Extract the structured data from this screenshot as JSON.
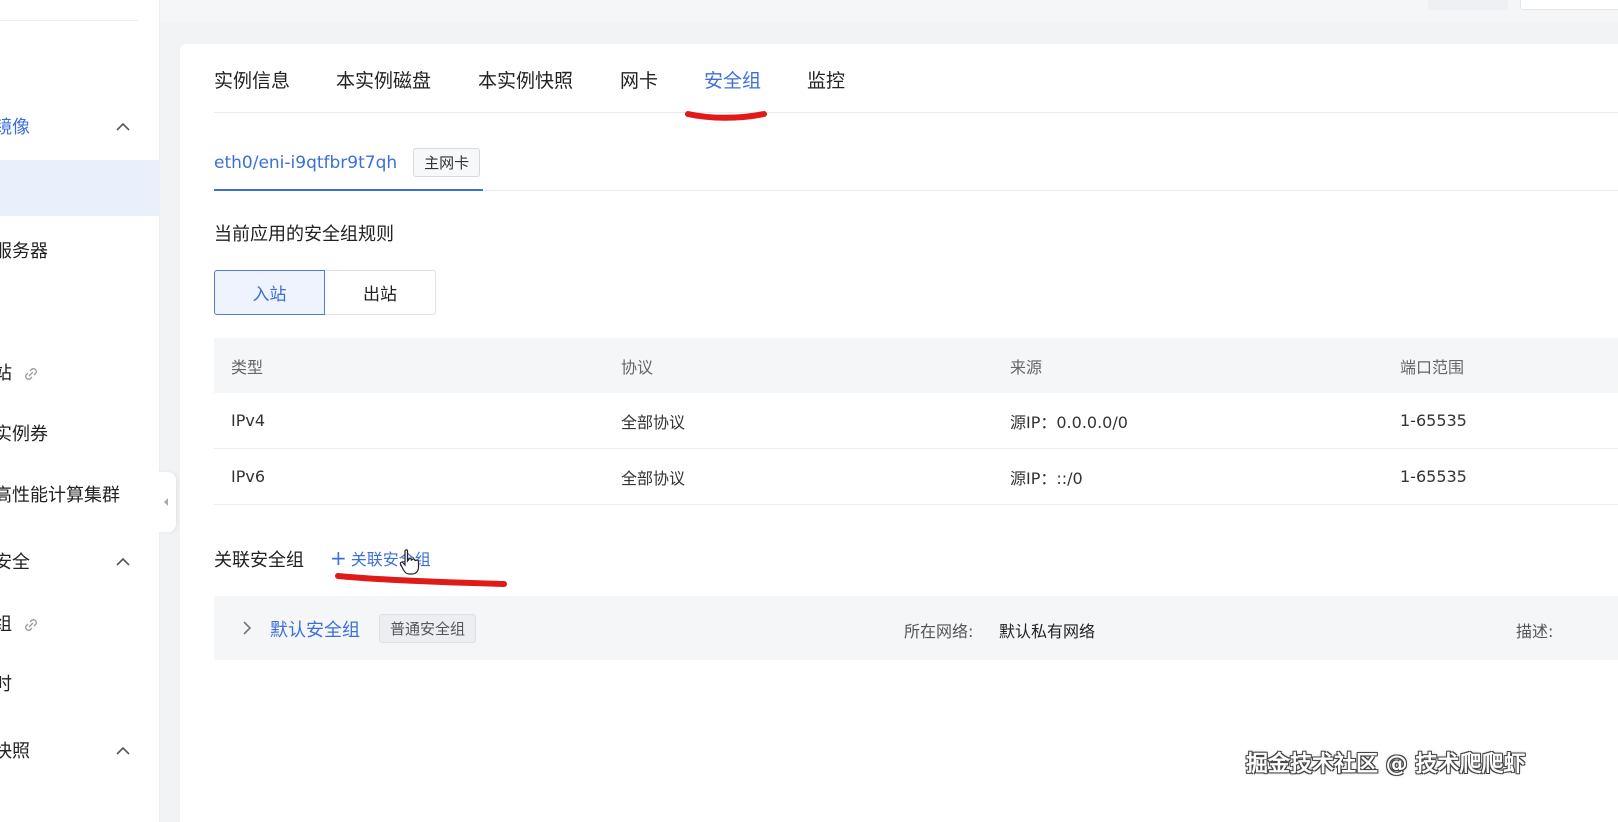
{
  "sidebar": {
    "items": [
      {
        "label": "镜像",
        "state": "group-expanded"
      },
      {
        "label": "",
        "state": "selected"
      },
      {
        "label": "服务器"
      },
      {
        "label": "站"
      },
      {
        "label": "实例券"
      },
      {
        "label": "高性能计算集群"
      },
      {
        "label": "安全",
        "state": "group-expanded"
      },
      {
        "label": "组"
      },
      {
        "label": "时"
      },
      {
        "label": "快照",
        "state": "group-expanded"
      }
    ]
  },
  "tabs": {
    "items": [
      "实例信息",
      "本实例磁盘",
      "本实例快照",
      "网卡",
      "安全组",
      "监控"
    ],
    "active": "安全组"
  },
  "nic": {
    "name": "eth0/eni-i9qtfbr9t7qh",
    "tag": "主网卡"
  },
  "rules_section": {
    "title": "当前应用的安全组规则",
    "directions": [
      "入站",
      "出站"
    ],
    "active_direction": "入站",
    "columns": [
      "类型",
      "协议",
      "来源",
      "端口范围"
    ],
    "rows": [
      [
        "IPv4",
        "全部协议",
        "源IP：0.0.0.0/0",
        "1-65535"
      ],
      [
        "IPv6",
        "全部协议",
        "源IP：::/0",
        "1-65535"
      ]
    ]
  },
  "associated": {
    "title": "关联安全组",
    "add_label": "关联安全组",
    "groups": [
      {
        "name": "默认安全组",
        "tag": "普通安全组",
        "network_label": "所在网络:",
        "network_value": "默认私有网络",
        "desc_label": "描述:"
      }
    ]
  },
  "watermark": "掘金技术社区 @ 技术爬爬虾",
  "colors": {
    "accent": "#3d6fd8",
    "annotation_red": "#e01919",
    "page_bg": "#f2f3f5"
  }
}
